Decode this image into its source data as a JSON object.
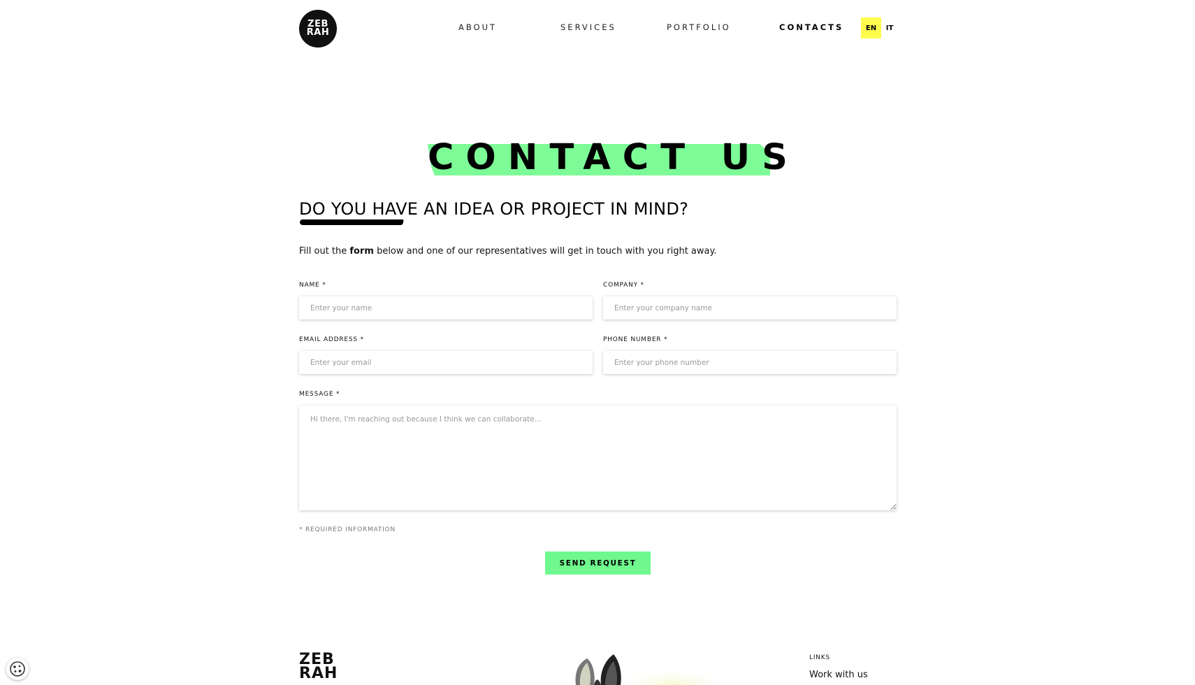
{
  "header": {
    "logo_line1": "ZEB",
    "logo_line2": "RAH",
    "nav": [
      "ABOUT",
      "SERVICES",
      "PORTFOLIO",
      "CONTACTS"
    ],
    "active_nav": "CONTACTS",
    "languages": [
      "EN",
      "IT"
    ],
    "active_language": "EN"
  },
  "hero": {
    "title": "CONTACT US",
    "subheading": "DO YOU HAVE AN IDEA OR PROJECT IN MIND?",
    "intro_before": "Fill out the ",
    "intro_bold": "form",
    "intro_after": " below and one of our representatives will get in touch with you right away."
  },
  "form": {
    "name": {
      "label": "NAME *",
      "placeholder": "Enter your name",
      "value": ""
    },
    "company": {
      "label": "COMPANY *",
      "placeholder": "Enter your company name",
      "value": ""
    },
    "email": {
      "label": "EMAIL ADDRESS *",
      "placeholder": "Enter your email",
      "value": ""
    },
    "phone": {
      "label": "PHONE NUMBER *",
      "placeholder": "Enter your phone number",
      "value": ""
    },
    "message": {
      "label": "MESSAGE *",
      "placeholder": "Hi there, I'm reaching out because I think we can collaborate...",
      "value": ""
    },
    "required_note": "* REQUIRED INFORMATION",
    "submit_label": "SEND REQUEST"
  },
  "footer": {
    "logo_line1": "ZEB",
    "logo_line2": "RAH",
    "links_title": "LINKS",
    "links": [
      "Work with us"
    ]
  },
  "colors": {
    "accent_green": "#7dfb97",
    "button_green": "#6ff88e",
    "lang_highlight": "#fffb4d",
    "text": "#111111"
  },
  "icons": {
    "cookie": "cookie-icon",
    "zebra": "zebra-ears-image"
  }
}
